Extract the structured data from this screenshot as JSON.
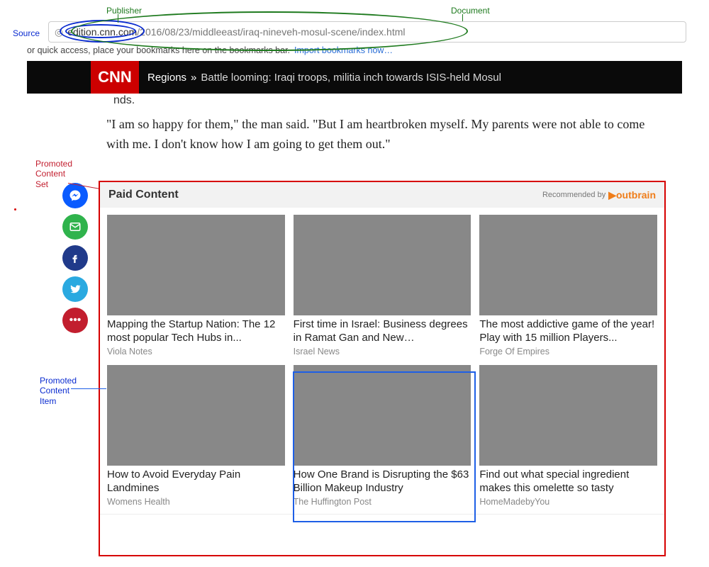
{
  "url": {
    "host": "edition.cnn.com",
    "path": "/2016/08/23/middleeast/iraq-nineveh-mosul-scene/index.html"
  },
  "bookmarks_hint": "or quick access, place your bookmarks here on the bookmarks bar.",
  "bookmarks_link": "Import bookmarks now…",
  "topnav": {
    "logo": "CNN",
    "region": "Regions",
    "sep": "»",
    "headline": "Battle looming: Iraqi troops, militia inch towards ISIS-held Mosul"
  },
  "fragment_word": "nds.",
  "article_quote": "\"I am so happy for them,\" the man said. \"But I am heartbroken myself. My parents were not able to come with me. I don't know how I am going to get them out.\"",
  "share": {
    "messenger": "messenger",
    "email": "email",
    "facebook": "facebook",
    "twitter": "twitter",
    "more": "more"
  },
  "paid": {
    "title": "Paid Content",
    "rec_by": "Recommended by",
    "outbrain": "outbrain",
    "items": [
      {
        "title": "Mapping the Startup Nation: The 12 most popular Tech Hubs in...",
        "source": "Viola Notes"
      },
      {
        "title": "First time in Israel: Business degrees in Ramat Gan and New…",
        "source": "Israel News"
      },
      {
        "title": "The most addictive game of the year! Play with 15 million Players...",
        "source": "Forge Of Empires"
      },
      {
        "title": "How to Avoid Everyday Pain Landmines",
        "source": "Womens Health"
      },
      {
        "title": "How One Brand is Disrupting the $63 Billion Makeup Industry",
        "source": "The Huffington Post"
      },
      {
        "title": "Find out what special ingredient makes this omelette so tasty",
        "source": "HomeMadebyYou"
      }
    ]
  },
  "annotations": {
    "publisher": "Publisher",
    "source": "Source",
    "document": "Document",
    "promoted_set": "Promoted\nContent\nSet",
    "promoted_item": "Promoted\nContent\nItem"
  }
}
